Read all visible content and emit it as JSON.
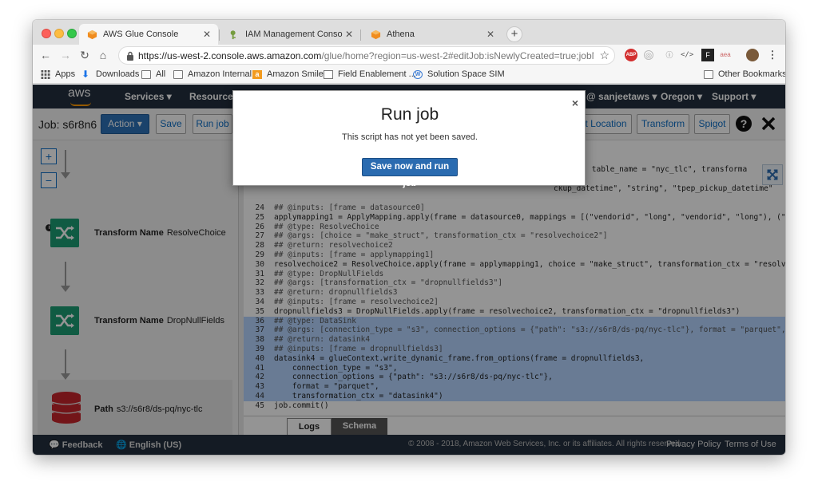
{
  "browser": {
    "tabs": [
      {
        "title": "AWS Glue Console",
        "icon": "aws-cube-icon",
        "active": true
      },
      {
        "title": "IAM Management Console",
        "icon": "iam-key-icon",
        "active": false
      },
      {
        "title": "Athena",
        "icon": "aws-cube-icon",
        "active": false
      }
    ],
    "url_main": "https://us-west-2.console.aws.amazon.com",
    "url_rest": "/glue/home?region=us-west-2#editJob:isNewlyCreated=true;jobName=s6...",
    "bookmarks": [
      {
        "label": "Apps",
        "icon": "apps-grid-icon"
      },
      {
        "label": "Downloads",
        "icon": "download-icon"
      },
      {
        "label": "All",
        "icon": "folder-icon"
      },
      {
        "label": "Amazon Internal",
        "icon": "folder-icon"
      },
      {
        "label": "Amazon Smile",
        "icon": "amazon-icon"
      },
      {
        "label": "Field Enablement ...",
        "icon": "page-icon"
      },
      {
        "label": "Solution Space SIM",
        "icon": "w-icon"
      }
    ],
    "other_bookmarks": "Other Bookmarks"
  },
  "aws_nav": {
    "logo": "aws",
    "services": "Services",
    "resource_groups": "Resource",
    "account": "@ sanjeetaws",
    "region": "Oregon",
    "support": "Support"
  },
  "jobbar": {
    "title": "Job: s6r8n6",
    "action": "Action",
    "save": "Save",
    "run_job": "Run job",
    "target_location": "t Location",
    "transform": "Transform",
    "spigot": "Spigot"
  },
  "diagram": {
    "zoom_in": "+",
    "zoom_out": "−",
    "nodes": [
      {
        "label_bold": "Transform Name",
        "label": "ResolveChoice"
      },
      {
        "label_bold": "Transform Name",
        "label": "DropNullFields"
      },
      {
        "label_bold": "Path",
        "label": "s3://s6r8/ds-pq/nyc-tlc"
      }
    ]
  },
  "code": {
    "top_fragments": [
      "6r8n6\", table_name = \"nyc_tlc\", transforma",
      "ckup_datetime\", \"string\", \"tpep_pickup_datetime\""
    ],
    "lines": [
      {
        "n": "24",
        "t": "## @inputs: [frame = datasource0]",
        "hl": false
      },
      {
        "n": "25",
        "t": "applymapping1 = ApplyMapping.apply(frame = datasource0, mappings = [(\"vendorid\", \"long\", \"vendorid\", \"long\"), (\"tpep_pick",
        "hl": false
      },
      {
        "n": "26",
        "t": "## @type: ResolveChoice",
        "hl": false
      },
      {
        "n": "27",
        "t": "## @args: [choice = \"make_struct\", transformation_ctx = \"resolvechoice2\"]",
        "hl": false
      },
      {
        "n": "28",
        "t": "## @return: resolvechoice2",
        "hl": false
      },
      {
        "n": "29",
        "t": "## @inputs: [frame = applymapping1]",
        "hl": false
      },
      {
        "n": "30",
        "t": "resolvechoice2 = ResolveChoice.apply(frame = applymapping1, choice = \"make_struct\", transformation_ctx = \"resolvechoice2\")",
        "hl": false
      },
      {
        "n": "31",
        "t": "## @type: DropNullFields",
        "hl": false
      },
      {
        "n": "32",
        "t": "## @args: [transformation_ctx = \"dropnullfields3\"]",
        "hl": false
      },
      {
        "n": "33",
        "t": "## @return: dropnullfields3",
        "hl": false
      },
      {
        "n": "34",
        "t": "## @inputs: [frame = resolvechoice2]",
        "hl": false
      },
      {
        "n": "35",
        "t": "dropnullfields3 = DropNullFields.apply(frame = resolvechoice2, transformation_ctx = \"dropnullfields3\")",
        "hl": false
      },
      {
        "n": "36",
        "t": "## @type: DataSink",
        "hl": true
      },
      {
        "n": "37",
        "t": "## @args: [connection_type = \"s3\", connection_options = {\"path\": \"s3://s6r8/ds-pq/nyc-tlc\"}, format = \"parquet\", transfor",
        "hl": true
      },
      {
        "n": "38",
        "t": "## @return: datasink4",
        "hl": true
      },
      {
        "n": "39",
        "t": "## @inputs: [frame = dropnullfields3]",
        "hl": true
      },
      {
        "n": "40",
        "t": "datasink4 = glueContext.write_dynamic_frame.from_options(frame = dropnullfields3,",
        "hl": true
      },
      {
        "n": "41",
        "t": "    connection_type = \"s3\",",
        "hl": true
      },
      {
        "n": "42",
        "t": "    connection_options = {\"path\": \"s3://s6r8/ds-pq/nyc-tlc\"},",
        "hl": true
      },
      {
        "n": "43",
        "t": "    format = \"parquet\",",
        "hl": true
      },
      {
        "n": "44",
        "t": "    transformation_ctx = \"datasink4\")",
        "hl": true
      },
      {
        "n": "45",
        "t": "job.commit()",
        "hl": false
      }
    ]
  },
  "panel_tabs": {
    "logs": "Logs",
    "schema": "Schema"
  },
  "footer": {
    "feedback": "Feedback",
    "language": "English (US)",
    "copyright": "© 2008 - 2018, Amazon Web Services, Inc. or its affiliates. All rights reserved.",
    "privacy": "Privacy Policy",
    "terms": "Terms of Use"
  },
  "modal": {
    "title": "Run job",
    "close": "×",
    "message": "This script has not yet been saved.",
    "button": "Save now and run job"
  },
  "colors": {
    "aws_dark": "#232f3e",
    "aws_orange": "#ff9900",
    "primary_blue": "#2a6bb0",
    "transform_green": "#1d9e74",
    "s3_red": "#c7252b",
    "code_highlight": "#b5d5ff"
  }
}
